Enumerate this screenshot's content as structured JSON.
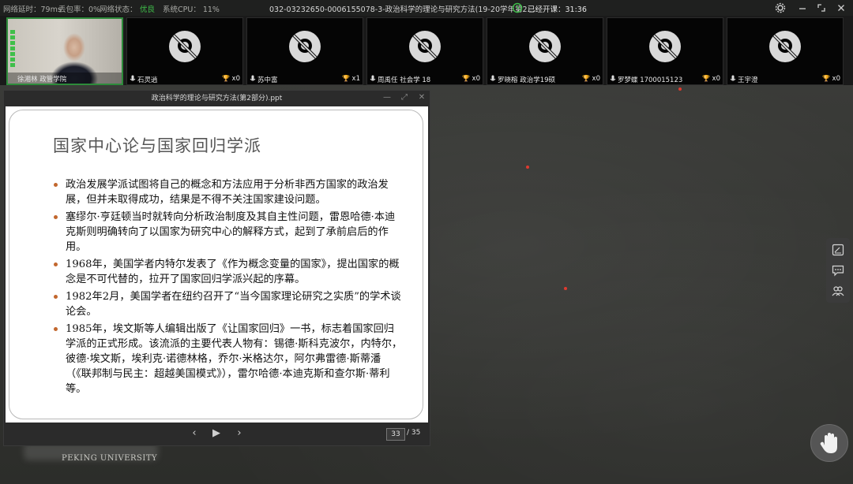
{
  "status_bar": {
    "latency": "网络延时：79ms",
    "packet_loss": "丢包率：0%",
    "network_state_label": "网络状态：",
    "network_state_value": "优良",
    "cpu": "系统CPU： 11%",
    "window_title": "032-03232650-0006155078-3-政治科学的理论与研究方法(19-20学年第2...",
    "elapsed": "已经开课：31:36",
    "colors": {
      "good": "#3fbf4a",
      "timer": "#3fbf4a"
    }
  },
  "participants": [
    {
      "name": "徐湘林 政管学院",
      "count": "",
      "active": true
    },
    {
      "name": "石灵逍",
      "count": "x0"
    },
    {
      "name": "苏中富",
      "count": "x1"
    },
    {
      "name": "周禹任 社会学 18",
      "count": "x0"
    },
    {
      "name": "罗晓榕 政治学19硕",
      "count": "x0"
    },
    {
      "name": "罗梦蝶 1700015123",
      "count": "x0"
    },
    {
      "name": "王宇澄",
      "count": "x0"
    }
  ],
  "slide_window": {
    "title": "政治科学的理论与研究方法(第2部分).ppt",
    "page_current": "33",
    "page_total": "/ 35"
  },
  "slide": {
    "title": "国家中心论与国家回归学派",
    "bullets": [
      "政治发展学派试图将自己的概念和方法应用于分析非西方国家的政治发展，但并未取得成功，结果是不得不关注国家建设问题。",
      "塞缪尔·亨廷顿当时就转向分析政治制度及其自主性问题，雷恩哈德·本迪克斯则明确转向了以国家为研究中心的解释方式，起到了承前启后的作用。",
      "1968年，美国学者内特尔发表了《作为概念变量的国家》，提出国家的概念是不可代替的，拉开了国家回归学派兴起的序幕。",
      "1982年2月，美国学者在纽约召开了“当今国家理论研究之实质”的学术谈论会。",
      "1985年，埃文斯等人编辑出版了《让国家回归》一书，标志着国家回归学派的正式形成。该流派的主要代表人物有：锡德·斯科克波尔，内特尔，彼德·埃文斯，埃利克·诺德林格，乔尔·米格达尔，阿尔弗雷德·斯蒂潘（《联邦制与民主：超越美国模式》），雷尔哈德·本迪克斯和查尔斯·蒂利等。"
    ]
  },
  "background": {
    "watermark": "PEKING UNIVERSITY"
  },
  "icons": {
    "status_ok": "check-circle-icon",
    "timer": "clock-icon",
    "settings": "gear-icon",
    "minimize": "minimize-icon",
    "maximize": "maximize-icon",
    "close": "close-icon",
    "camera_off": "camera-off-icon",
    "mic": "mic-icon",
    "trophy": "trophy-icon",
    "prev": "chevron-left-icon",
    "play": "play-icon",
    "next": "chevron-right-icon",
    "side_tool_1": "document-edit-icon",
    "side_tool_2": "chat-icon",
    "side_tool_3": "people-icon",
    "hand": "raise-hand-icon"
  }
}
